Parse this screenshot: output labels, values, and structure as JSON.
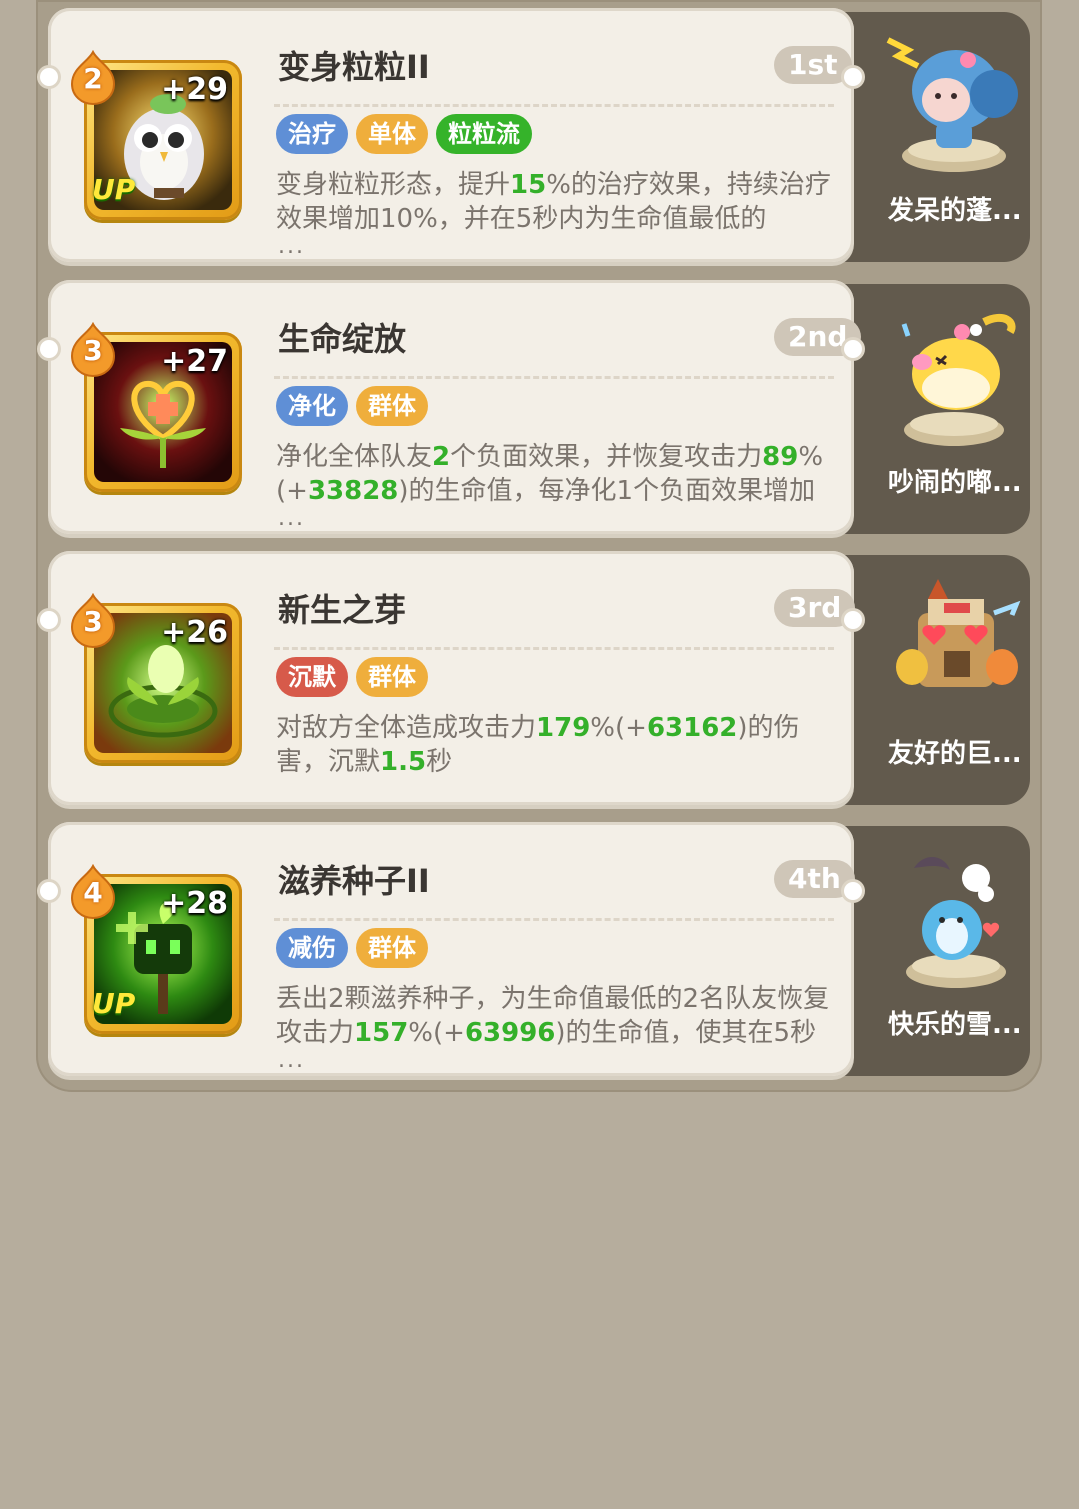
{
  "colors": {
    "tag_blue": "#5f8fd6",
    "tag_orange": "#efae3c",
    "tag_green": "#35b32a",
    "tag_red": "#d75a4a",
    "value_green": "#34b02a"
  },
  "skills": [
    {
      "level": "2",
      "bonus": "+29",
      "up": "UP",
      "title": "变身粒粒II",
      "rank": "1st",
      "tags": [
        {
          "label": "治疗",
          "color": "blue"
        },
        {
          "label": "单体",
          "color": "orange"
        },
        {
          "label": "粒粒流",
          "color": "green"
        }
      ],
      "desc": [
        {
          "t": "变身粒粒形态，提升"
        },
        {
          "t": "15",
          "hl": true
        },
        {
          "t": "%的治疗效果，持续治疗效果增加10%，并在5秒内为生命值最低的"
        }
      ],
      "ellipsis": "...",
      "pet": {
        "name": "发呆的蓬...",
        "icon": "sheep-pet-icon"
      },
      "icon": "owl-skill-icon"
    },
    {
      "level": "3",
      "bonus": "+27",
      "up": "",
      "title": "生命绽放",
      "rank": "2nd",
      "tags": [
        {
          "label": "净化",
          "color": "blue"
        },
        {
          "label": "群体",
          "color": "orange"
        }
      ],
      "desc": [
        {
          "t": "净化全体队友"
        },
        {
          "t": "2",
          "hl": true
        },
        {
          "t": "个负面效果，并恢复攻击力"
        },
        {
          "t": "89",
          "hl": true
        },
        {
          "t": "%(+"
        },
        {
          "t": "33828",
          "hl": true
        },
        {
          "t": ")的生命值，每净化1个负面效果增加"
        }
      ],
      "ellipsis": "...",
      "pet": {
        "name": "吵闹的嘟...",
        "icon": "chick-pet-icon"
      },
      "icon": "heart-sprout-skill-icon"
    },
    {
      "level": "3",
      "bonus": "+26",
      "up": "",
      "title": "新生之芽",
      "rank": "3rd",
      "tags": [
        {
          "label": "沉默",
          "color": "red"
        },
        {
          "label": "群体",
          "color": "orange"
        }
      ],
      "desc": [
        {
          "t": "对敌方全体造成攻击力"
        },
        {
          "t": "179",
          "hl": true
        },
        {
          "t": "%(+"
        },
        {
          "t": "63162",
          "hl": true
        },
        {
          "t": ")的伤害，沉默"
        },
        {
          "t": "1.5",
          "hl": true
        },
        {
          "t": "秒"
        }
      ],
      "ellipsis": "",
      "pet": {
        "name": "友好的巨...",
        "icon": "golem-pet-icon"
      },
      "icon": "seedling-skill-icon"
    },
    {
      "level": "4",
      "bonus": "+28",
      "up": "UP",
      "title": "滋养种子II",
      "rank": "4th",
      "tags": [
        {
          "label": "减伤",
          "color": "blue"
        },
        {
          "label": "群体",
          "color": "orange"
        }
      ],
      "desc": [
        {
          "t": "丢出2颗滋养种子，为生命值最低的2名队友恢复攻击力"
        },
        {
          "t": "157",
          "hl": true
        },
        {
          "t": "%(+"
        },
        {
          "t": "63996",
          "hl": true
        },
        {
          "t": ")的生命值，使其在5秒"
        }
      ],
      "ellipsis": "...",
      "pet": {
        "name": "快乐的雪...",
        "icon": "snow-creature-pet-icon"
      },
      "icon": "seed-sprite-skill-icon"
    }
  ]
}
